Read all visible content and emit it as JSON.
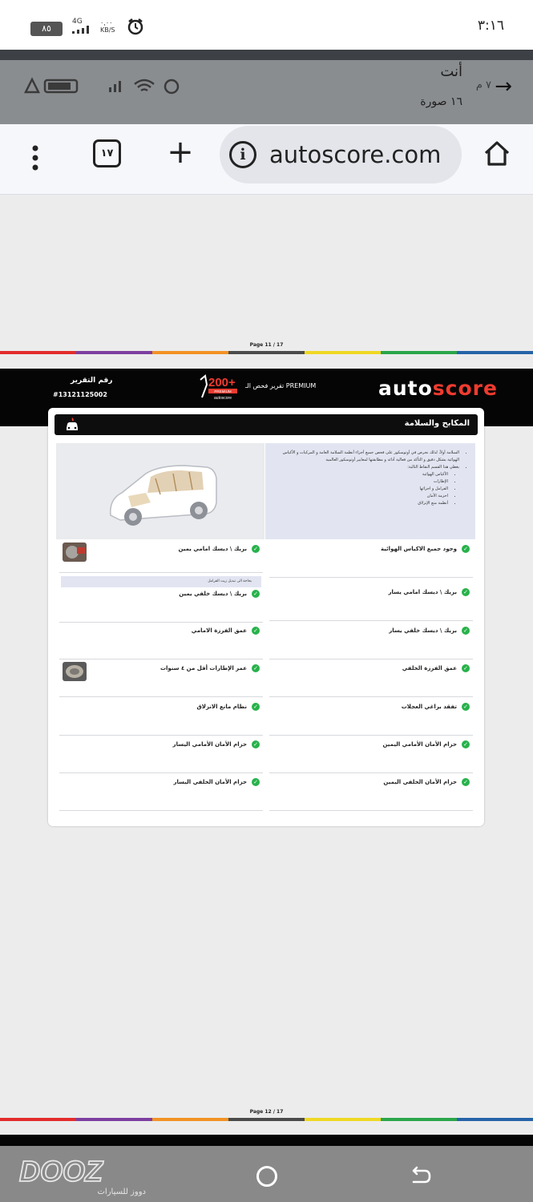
{
  "status_bar": {
    "time": "٣:١٦",
    "battery": "٨٥",
    "network": "4G",
    "speed": "٠,٠٠ KB/S"
  },
  "notification": {
    "sender": "أنت",
    "subtitle": "١٦ صورة",
    "time": "٧ م"
  },
  "browser": {
    "url": "autoscore.com",
    "tab_count": "١٧"
  },
  "pdf": {
    "page_prev": "Page 11 / 17",
    "page_current": "Page 12 / 17",
    "divider_colors": [
      "#e32b2b",
      "#7c3fa0",
      "#f29223",
      "#4b4b4b",
      "#efd824",
      "#2aa64a",
      "#2563a8"
    ]
  },
  "report": {
    "logo_main": "auto",
    "logo_accent": "score",
    "premium_label": "تقرير فحص الـ PREMIUM",
    "badge_number": "200+",
    "badge_text": "PREMIUM",
    "badge_brand": "autoscore",
    "report_no_label": "رقم التقرير",
    "report_no": "#13121125002",
    "section_title": "المكابح والسلامة",
    "description": {
      "intro": "السلامة أولاً، لذلك نحرص في أوتوسكور على فحص جميع أجزاء أنظمة السلامة العامة و المركبات و الأكياس الهوائية بشكل دقيق و التأكد من فعالية أدائه و مطابقتها لمعايير أوتوسكور العالمية",
      "covers": "يغطي هذا القسم النقاط التالية:",
      "points": [
        "الأكياس الهوائية",
        "الإطارات",
        "الفرامل و اجزائها",
        "احزمة الأمان",
        "أنظمة منع الإنزلاق"
      ]
    },
    "note": "بحاجة الى تبديل زيت الفرامل",
    "items_right": [
      "وجود جميع الاكياس الهوائية",
      "بريك \\ ديسك امامي يسار",
      "بريك \\ ديسك خلفي يسار",
      "عمق الفرزة الخلفي",
      "تفقد براغي العجلات",
      "حزام الأمان الأمامي اليمين",
      "حزام الأمان الخلفي اليمين"
    ],
    "items_left": [
      "بريك \\ ديسك امامي يمين",
      "بريك \\ ديسك خلفي يمين",
      "عمق الفرزة الامامي",
      "عمر الإطارات أقل من ٤ سنوات",
      "نظام مانع الانزلاق",
      "حزام الأمان الأمامي اليسار",
      "حزام الأمان الخلفي اليسار"
    ],
    "check_color": "#27b24a",
    "accent_color": "#ef3b2f"
  },
  "watermark": {
    "brand": "DOOZ",
    "sub": "دووز للسيارات"
  }
}
